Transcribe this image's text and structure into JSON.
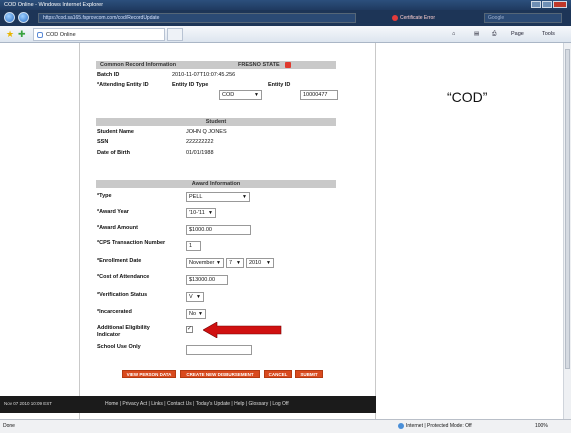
{
  "browser": {
    "window_title": "COD Online - Windows Internet Explorer",
    "url": "https://cod.sa165.fsprovcom.com/cod/RecordUpdate",
    "cert_error": "Certificate Error",
    "search_placeholder": "Google",
    "tab_title": "COD Online",
    "commands": {
      "home": "⌂",
      "feeds": "▤",
      "print": "⎙",
      "page": "Page",
      "tools": "Tools"
    },
    "status": {
      "left": "Done",
      "zone": "Internet | Protected Mode: Off",
      "zoom": "100%"
    }
  },
  "common_record": {
    "header": "Common Record Information",
    "school": "FRESNO STATE",
    "batch_id_label": "Batch ID",
    "batch_id_value": "2010-11-07T10:07:45.256",
    "attending_entity_label": "*Attending Entity ID",
    "entity_id_type_label": "Entity ID Type",
    "entity_id_type_value": "COD",
    "entity_id_label": "Entity ID",
    "entity_id_value": "10000477"
  },
  "student": {
    "header": "Student",
    "name_label": "Student Name",
    "name_value": "JOHN Q JONES",
    "ssn_label": "SSN",
    "ssn_value": "222222222",
    "dob_label": "Date of Birth",
    "dob_value": "01/01/1988"
  },
  "award": {
    "header": "Award Information",
    "type_label": "*Type",
    "type_value": "PELL",
    "award_year_label": "*Award Year",
    "award_year_value": "'10-'11",
    "award_amount_label": "*Award Amount",
    "award_amount_value": "$1000.00",
    "cps_label": "*CPS Transaction Number",
    "cps_value": "1",
    "enrollment_label": "*Enrollment Date",
    "enrollment_month": "November",
    "enrollment_day": "7",
    "enrollment_year": "2010",
    "coa_label": "*Cost of Attendance",
    "coa_value": "$13000.00",
    "verification_label": "*Verification Status",
    "verification_value": "V",
    "incarcerated_label": "*Incarcerated",
    "incarcerated_value": "No",
    "add_elig_label_1": "Additional Eligibility",
    "add_elig_label_2": "Indicator",
    "add_elig_checked": "✓",
    "school_use_label": "School Use Only",
    "school_use_value": ""
  },
  "buttons": {
    "view_person": "VIEW PERSON DATA",
    "create_disb": "CREATE NEW DISBURSEMENT",
    "cancel": "CANCEL",
    "submit": "SUBMIT"
  },
  "footer": {
    "timestamp": "Nov 07 2010 10:09 EST",
    "links": [
      "Home",
      "Privacy Act",
      "Links",
      "Contact Us",
      "Today's Update",
      "Help",
      "Glossary",
      "Log Off"
    ]
  },
  "annotation": {
    "text": "“COD”",
    "arrow_color": "#d01010"
  }
}
